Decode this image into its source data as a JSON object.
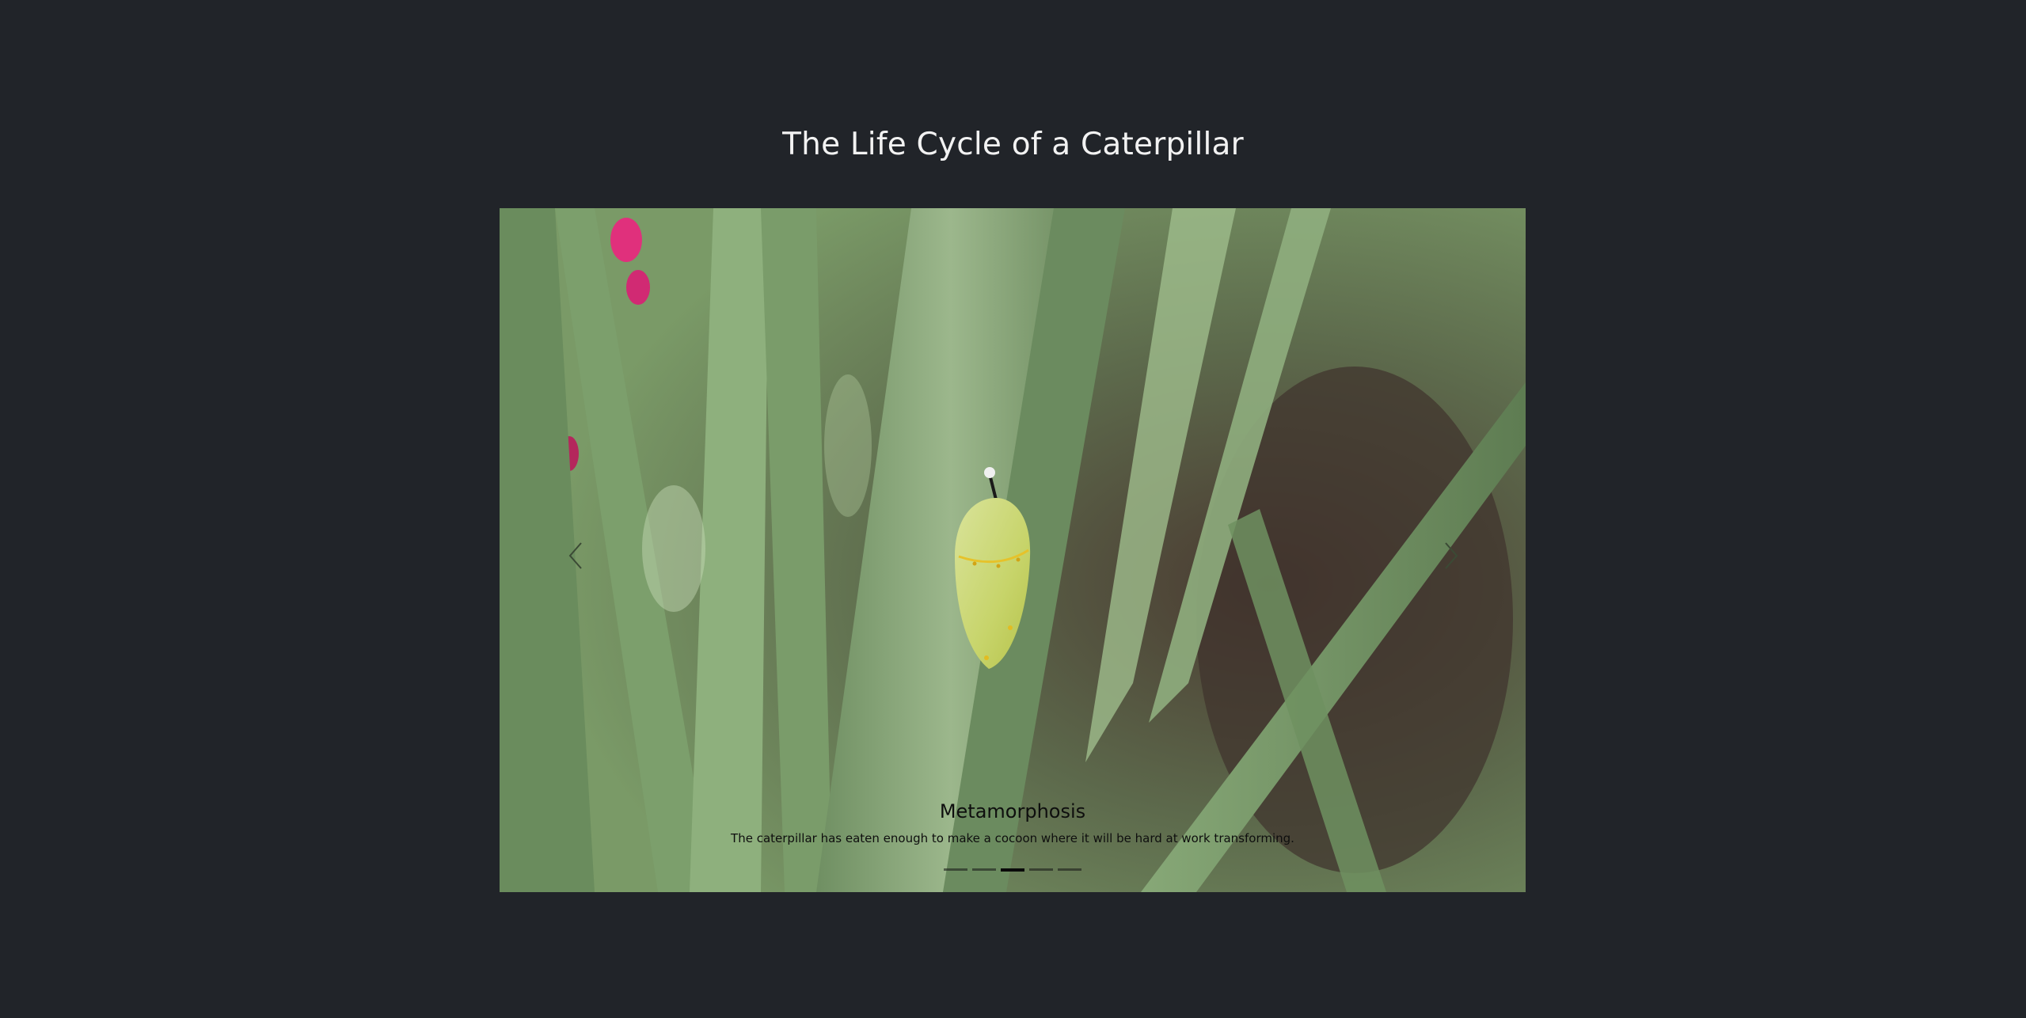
{
  "page": {
    "title": "The Life Cycle of a Caterpillar"
  },
  "carousel": {
    "active_index": 2,
    "slide_count": 5,
    "caption_title": "Metamorphosis",
    "caption_text": "The caterpillar has eaten enough to make a cocoon where it will be hard at work transforming.",
    "prev_icon": "chevron-left-icon",
    "next_icon": "chevron-right-icon",
    "image_subject": "chrysalis-on-leaf-photo"
  },
  "colors": {
    "background": "#212429",
    "title_text": "#f2f2f2",
    "caption_text": "#0e0e0e"
  }
}
